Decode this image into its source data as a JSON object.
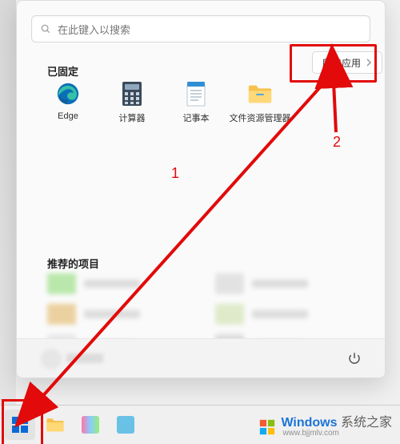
{
  "search": {
    "placeholder": "在此键入以搜索"
  },
  "sections": {
    "pinned": "已固定",
    "recommended": "推荐的项目"
  },
  "all_apps": {
    "label": "所有应用"
  },
  "apps": {
    "edge": "Edge",
    "calculator": "计算器",
    "notepad": "记事本",
    "explorer": "文件资源管理器"
  },
  "annotation": {
    "num1": "1",
    "num2": "2"
  },
  "watermark": {
    "brand1": "Windows",
    "brand2": "系统之家",
    "url": "www.bjjmlv.com"
  }
}
